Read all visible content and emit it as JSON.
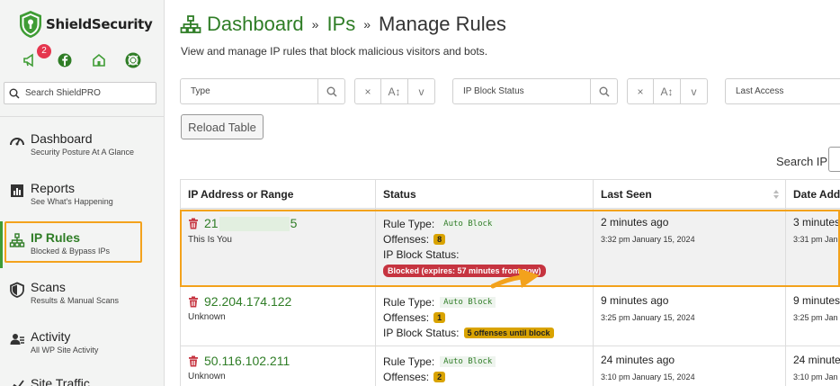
{
  "brand": {
    "name": "ShieldSecurity",
    "accent": "#3f9c35",
    "highlight": "#f3a21c"
  },
  "sidebar": {
    "notification_count": "2",
    "icons": [
      "megaphone-icon",
      "facebook-icon",
      "home-icon",
      "support-icon"
    ],
    "search_label": "Search ShieldPRO",
    "items": [
      {
        "title": "Dashboard",
        "subtitle": "Security Posture At A Glance",
        "icon": "gauge-icon"
      },
      {
        "title": "Reports",
        "subtitle": "See What's Happening",
        "icon": "report-icon"
      },
      {
        "title": "IP Rules",
        "subtitle": "Blocked & Bypass IPs",
        "icon": "network-icon",
        "active": true
      },
      {
        "title": "Scans",
        "subtitle": "Results & Manual Scans",
        "icon": "shield-icon"
      },
      {
        "title": "Activity",
        "subtitle": "All WP Site Activity",
        "icon": "users-icon"
      },
      {
        "title": "Site Traffic",
        "subtitle": "",
        "icon": "traffic-icon"
      }
    ]
  },
  "header": {
    "breadcrumb": [
      "Dashboard",
      "IPs",
      "Manage Rules"
    ],
    "separator": "»",
    "description": "View and manage IP rules that block malicious visitors and bots."
  },
  "filters": [
    {
      "placeholder": "Type"
    },
    {
      "placeholder": "IP Block Status"
    },
    {
      "placeholder": "Last Access"
    }
  ],
  "filter_buttons": {
    "clear": "×",
    "sort": "A↕",
    "toggle": "v"
  },
  "reload_label": "Reload Table",
  "search_ip_label": "Search IP",
  "table": {
    "headers": [
      "IP Address or Range",
      "Status",
      "Last Seen",
      "Date Add"
    ],
    "labels": {
      "rule_type": "Rule Type:",
      "offenses": "Offenses:",
      "block_status": "IP Block Status:"
    },
    "rows": [
      {
        "ip_prefix": "21",
        "ip_suffix": "5",
        "note": "This Is You",
        "rule_type": "Auto Block",
        "offenses": "8",
        "block_status": "Blocked (expires: 57 minutes from now)",
        "last_seen": "2 minutes ago",
        "last_seen_date": "3:32 pm January 15, 2024",
        "date_added": "3 minutes",
        "date_added_date": "3:31 pm Jan"
      },
      {
        "ip": "92.204.174.122",
        "note": "Unknown",
        "rule_type": "Auto Block",
        "offenses": "1",
        "block_status": "5 offenses until block",
        "last_seen": "9 minutes ago",
        "last_seen_date": "3:25 pm January 15, 2024",
        "date_added": "9 minutes",
        "date_added_date": "3:25 pm Jan"
      },
      {
        "ip": "50.116.102.211",
        "note": "Unknown",
        "rule_type": "Auto Block",
        "offenses": "2",
        "last_seen": "24 minutes ago",
        "last_seen_date": "3:10 pm January 15, 2024",
        "date_added": "24 minutes",
        "date_added_date": "3:10 pm Jan"
      }
    ]
  }
}
